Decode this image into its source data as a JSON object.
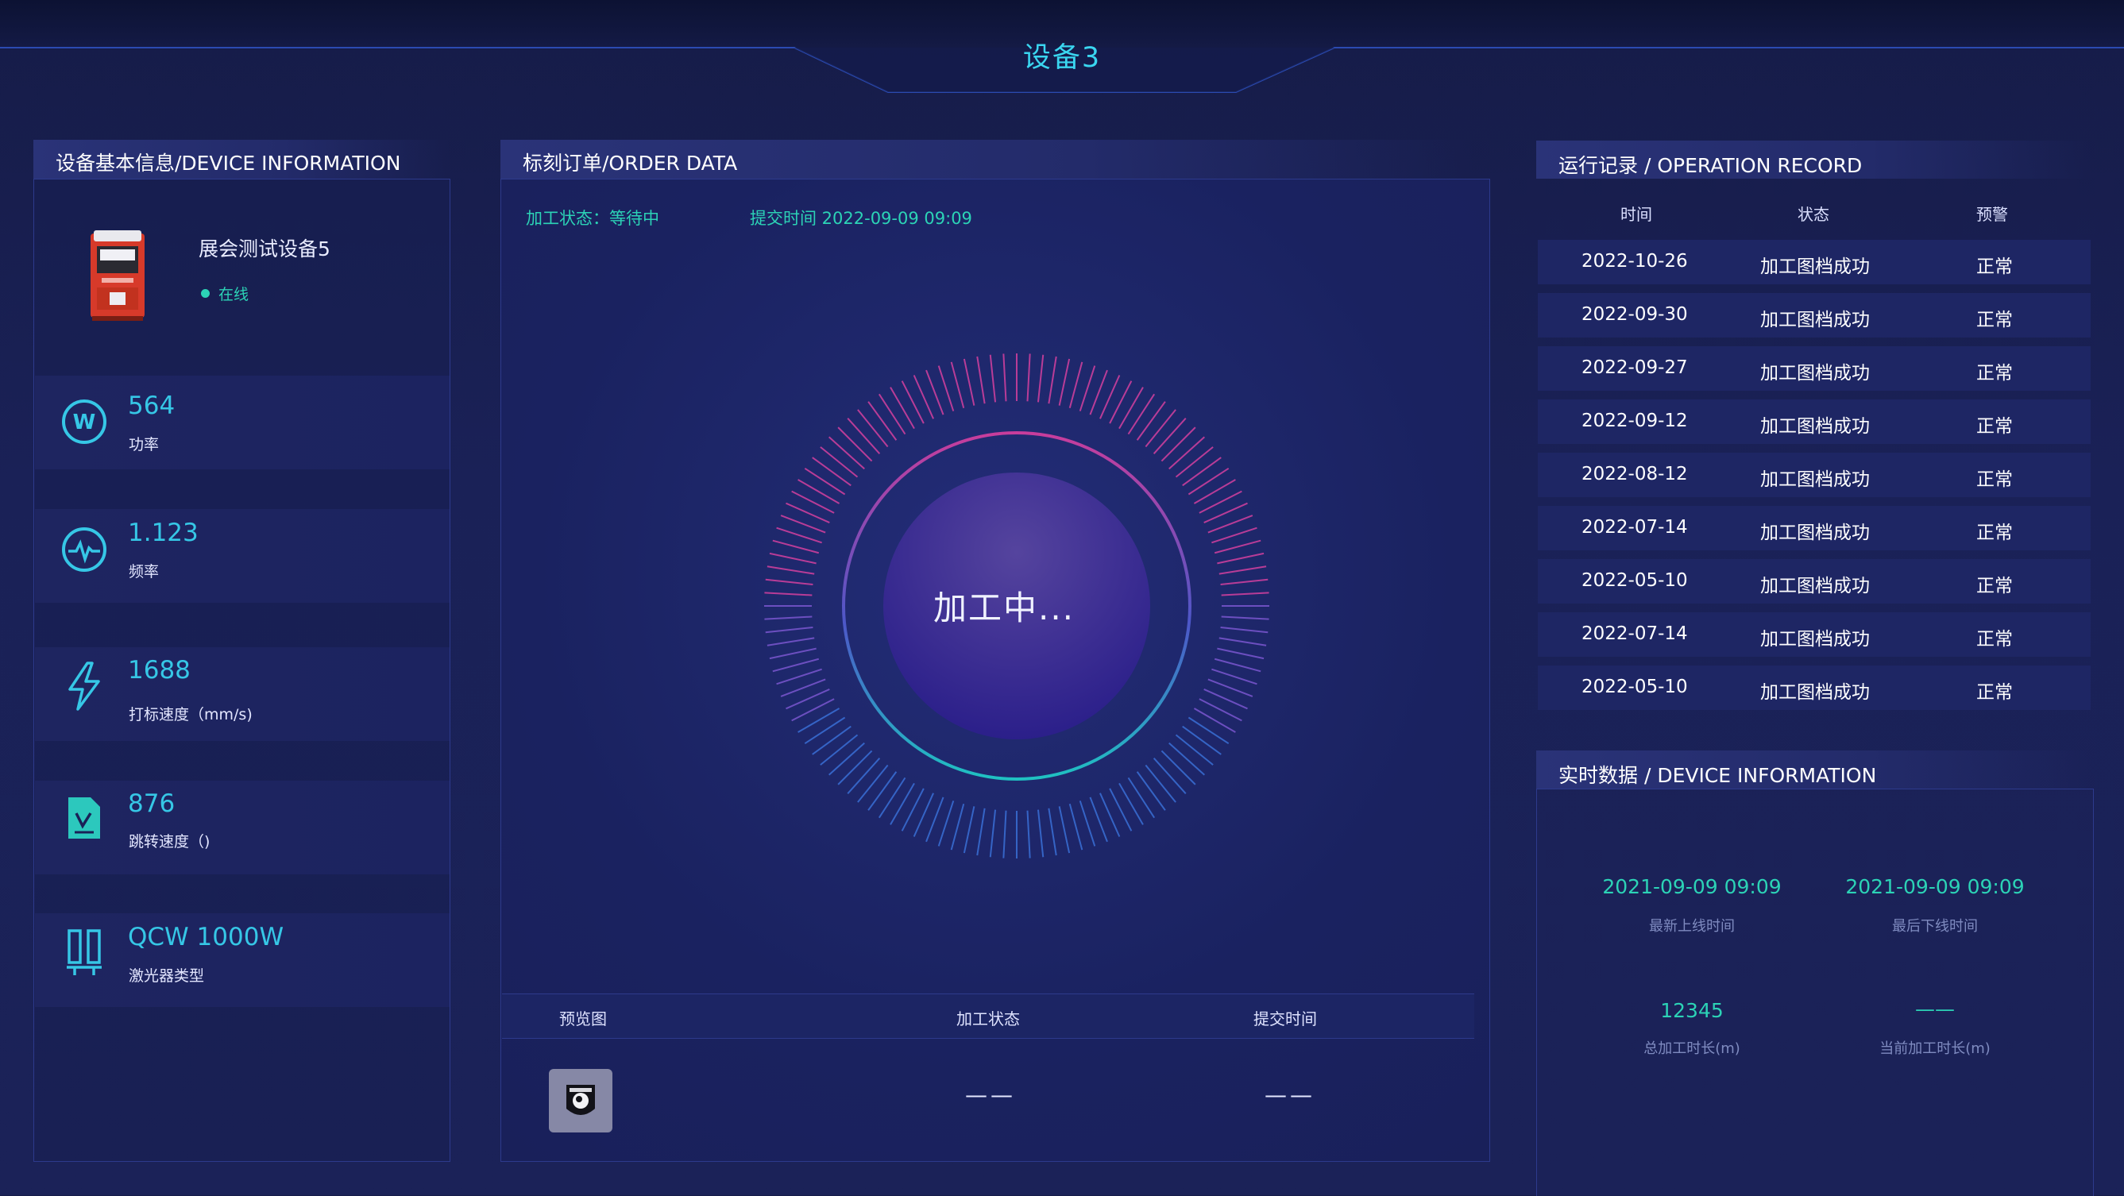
{
  "header": {
    "title": "设备3"
  },
  "left_panel": {
    "title": "设备基本信息/DEVICE INFORMATION",
    "device_name": "展会测试设备5",
    "status": "在线",
    "metrics": [
      {
        "icon": "power-w-icon",
        "value": "564",
        "label": "功率"
      },
      {
        "icon": "pulse-icon",
        "value": "1.123",
        "label": "频率"
      },
      {
        "icon": "lightning-icon",
        "value": "1688",
        "label": "打标速度（mm/s)"
      },
      {
        "icon": "document-check-icon",
        "value": "876",
        "label": "跳转速度（)"
      },
      {
        "icon": "laser-type-icon",
        "value": "QCW 1000W",
        "label": "激光器类型"
      }
    ]
  },
  "center_panel": {
    "title": "标刻订单/ORDER DATA",
    "status_line": "加工状态：等待中",
    "submit_time_line": "提交时间 2022-09-09 09:09",
    "dial_text": "加工中...",
    "table": {
      "headers": [
        "预览图",
        "加工状态",
        "提交时间"
      ],
      "rows": [
        {
          "status": "——",
          "time": "——"
        }
      ]
    }
  },
  "operation_record": {
    "title": "运行记录 / OPERATION RECORD",
    "headers": [
      "时间",
      "状态",
      "预警"
    ],
    "rows": [
      {
        "time": "2022-10-26",
        "status": "加工图档成功",
        "warn": "正常"
      },
      {
        "time": "2022-09-30",
        "status": "加工图档成功",
        "warn": "正常"
      },
      {
        "time": "2022-09-27",
        "status": "加工图档成功",
        "warn": "正常"
      },
      {
        "time": "2022-09-12",
        "status": "加工图档成功",
        "warn": "正常"
      },
      {
        "time": "2022-08-12",
        "status": "加工图档成功",
        "warn": "正常"
      },
      {
        "time": "2022-07-14",
        "status": "加工图档成功",
        "warn": "正常"
      },
      {
        "time": "2022-05-10",
        "status": "加工图档成功",
        "warn": "正常"
      },
      {
        "time": "2022-07-14",
        "status": "加工图档成功",
        "warn": "正常"
      },
      {
        "time": "2022-05-10",
        "status": "加工图档成功",
        "warn": "正常"
      }
    ]
  },
  "realtime": {
    "title": "实时数据 / DEVICE INFORMATION",
    "items": [
      {
        "value": "2021-09-09 09:09",
        "label": "最新上线时间"
      },
      {
        "value": "2021-09-09 09:09",
        "label": "最后下线时间"
      },
      {
        "value": "12345",
        "label": "总加工时长(m)"
      },
      {
        "value": "——",
        "label": "当前加工时长(m)"
      }
    ]
  },
  "colors": {
    "accent_cyan": "#36c7e6",
    "accent_green": "#2cd3b6",
    "background": "#1a2157",
    "ring_pink": "#d43a9a"
  }
}
